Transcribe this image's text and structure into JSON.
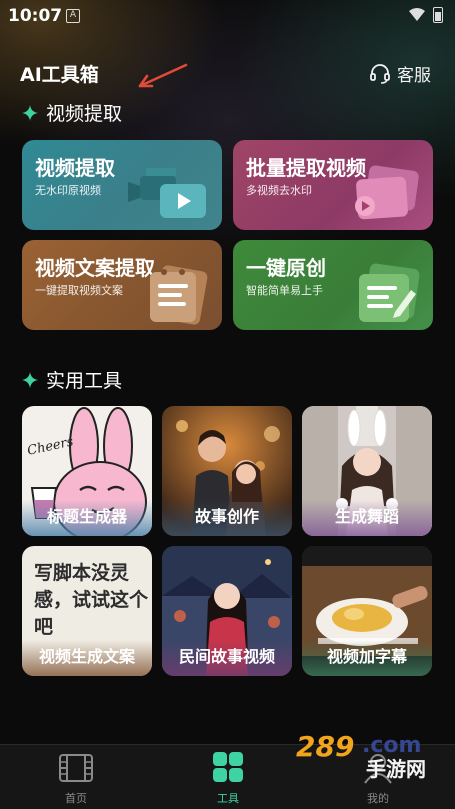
{
  "status_bar": {
    "time": "10:07",
    "notif_glyph": "A"
  },
  "header": {
    "title": "AI工具箱",
    "service_label": "客服"
  },
  "sections": {
    "extract": "视频提取",
    "tools": "实用工具"
  },
  "feature_cards": [
    {
      "title": "视频提取",
      "subtitle": "无水印原视频",
      "icon": "video-camera-icon"
    },
    {
      "title": "批量提取视频",
      "subtitle": "多视频去水印",
      "icon": "video-stack-icon"
    },
    {
      "title": "视频文案提取",
      "subtitle": "一键提取视频文案",
      "icon": "document-icon"
    },
    {
      "title": "一键原创",
      "subtitle": "智能简单易上手",
      "icon": "edit-document-icon"
    }
  ],
  "tool_tiles": [
    {
      "label": "标题生成器",
      "art_text": "Cheers"
    },
    {
      "label": "故事创作"
    },
    {
      "label": "生成舞蹈"
    },
    {
      "label": "视频生成文案",
      "art_text": "写脚本没灵感，试试这个吧"
    },
    {
      "label": "民间故事视频"
    },
    {
      "label": "视频加字幕"
    }
  ],
  "bottom_nav": [
    {
      "label": "首页",
      "icon": "film-icon",
      "active": false
    },
    {
      "label": "工具",
      "icon": "grid-icon",
      "active": true
    },
    {
      "label": "我的",
      "icon": "person-icon",
      "active": false
    }
  ],
  "watermark": {
    "number": "289",
    "suffix": ".com",
    "text": "手游网"
  },
  "colors": {
    "accent": "#3fd2a3",
    "background": "#0b0b0b"
  }
}
